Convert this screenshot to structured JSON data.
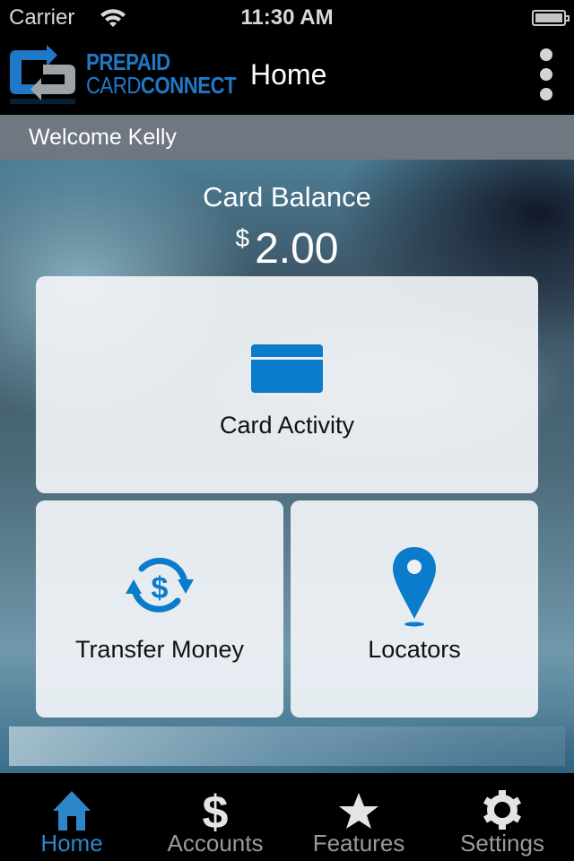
{
  "status_bar": {
    "carrier": "Carrier",
    "time": "11:30 AM",
    "icons": [
      "wifi-icon",
      "battery-icon"
    ]
  },
  "nav_bar": {
    "logo": {
      "line1": "PREPAID",
      "line2_light": "CARD",
      "line2_bold": "CONNECT"
    },
    "title": "Home",
    "menu_icon": "more-vertical-icon"
  },
  "welcome": {
    "text": "Welcome Kelly"
  },
  "balance": {
    "label": "Card Balance",
    "currency": "$",
    "amount": "2.00"
  },
  "tiles": [
    {
      "label": "Card Activity",
      "icon": "credit-card-icon"
    },
    {
      "label": "Transfer Money",
      "icon": "money-transfer-icon"
    },
    {
      "label": "Locators",
      "icon": "map-pin-icon"
    }
  ],
  "tab_bar": {
    "items": [
      {
        "label": "Home",
        "icon": "home-icon",
        "active": true
      },
      {
        "label": "Accounts",
        "icon": "dollar-icon",
        "active": false
      },
      {
        "label": "Features",
        "icon": "star-icon",
        "active": false
      },
      {
        "label": "Settings",
        "icon": "gear-icon",
        "active": false
      }
    ]
  },
  "colors": {
    "brand_blue": "#1f78c8",
    "icon_blue": "#0a7ccb",
    "tab_active": "#2d86c8",
    "tab_inactive": "#9a9a9a",
    "welcome_bar": "#6f7780"
  }
}
